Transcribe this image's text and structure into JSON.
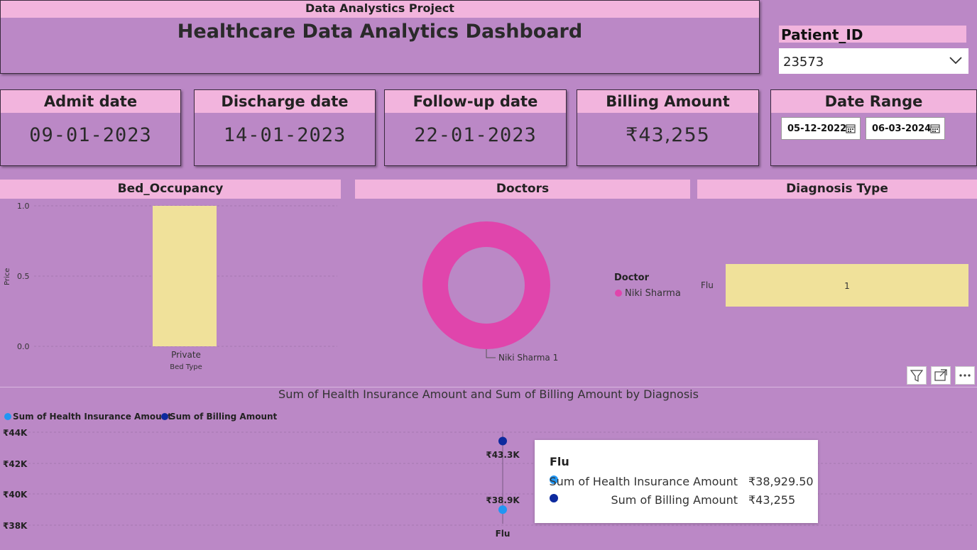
{
  "header": {
    "subtitle": "Data Analystics Project",
    "title": "Healthcare Data Analytics Dashboard"
  },
  "patient": {
    "label": "Patient_ID",
    "selected": "23573"
  },
  "kpis": [
    {
      "label": "Admit date",
      "value": "09-01-2023"
    },
    {
      "label": "Discharge date",
      "value": "14-01-2023"
    },
    {
      "label": "Follow-up date",
      "value": "22-01-2023"
    },
    {
      "label": "Billing Amount",
      "value": "₹43,255"
    }
  ],
  "date_range": {
    "label": "Date Range",
    "start": "05-12-2022",
    "end": "06-03-2024"
  },
  "bed": {
    "title": "Bed_Occupancy",
    "ylabel": "Price",
    "xlabel": "Bed Type",
    "ticks": [
      "1.0",
      "0.5",
      "0.0"
    ]
  },
  "doctors": {
    "title": "Doctors",
    "legend_title": "Doctor",
    "legend_item": "Niki Sharma",
    "slice_label": "Niki Sharma 1"
  },
  "diagnosis": {
    "title": "Diagnosis Type",
    "category": "Flu",
    "value_label": "1"
  },
  "combo": {
    "title": "Sum of Health Insurance Amount and Sum of Billing Amount by Diagnosis",
    "legend": [
      "Sum of Health Insurance Amount",
      "Sum of Billing Amount"
    ],
    "y_ticks": [
      "₹44K",
      "₹42K",
      "₹40K",
      "₹38K"
    ],
    "billing_label": "₹43.3K",
    "insurance_label": "₹38.9K",
    "x_label": "Flu"
  },
  "tooltip": {
    "title": "Flu",
    "rows": [
      {
        "name": "Sum of Health Insurance Amount",
        "value": "₹38,929.50"
      },
      {
        "name": "Sum of Billing Amount",
        "value": "₹43,255"
      }
    ]
  },
  "colors": {
    "panel": "#bb88c6",
    "header": "#f2b4dd",
    "bar": "#f0e19a",
    "donut": "#e045ac",
    "insurance": "#2196f3",
    "billing": "#0d2a9e"
  },
  "chart_data": [
    {
      "type": "bar",
      "title": "Bed_Occupancy",
      "categories": [
        "Private"
      ],
      "values": [
        1.0
      ],
      "xlabel": "Bed Type",
      "ylabel": "Price",
      "ylim": [
        0,
        1.0
      ],
      "grid": true
    },
    {
      "type": "pie",
      "title": "Doctors",
      "categories": [
        "Niki Sharma"
      ],
      "values": [
        1
      ],
      "legend": "right"
    },
    {
      "type": "bar",
      "title": "Diagnosis Type",
      "orientation": "horizontal",
      "categories": [
        "Flu"
      ],
      "values": [
        1
      ],
      "xlim": [
        0,
        1
      ]
    },
    {
      "type": "scatter",
      "title": "Sum of Health Insurance Amount and Sum of Billing Amount by Diagnosis",
      "categories": [
        "Flu"
      ],
      "series": [
        {
          "name": "Sum of Health Insurance Amount",
          "values": [
            38929.5
          ]
        },
        {
          "name": "Sum of Billing Amount",
          "values": [
            43255
          ]
        }
      ],
      "ylim": [
        37500,
        44400
      ],
      "legend": "top-left",
      "grid": true
    }
  ]
}
